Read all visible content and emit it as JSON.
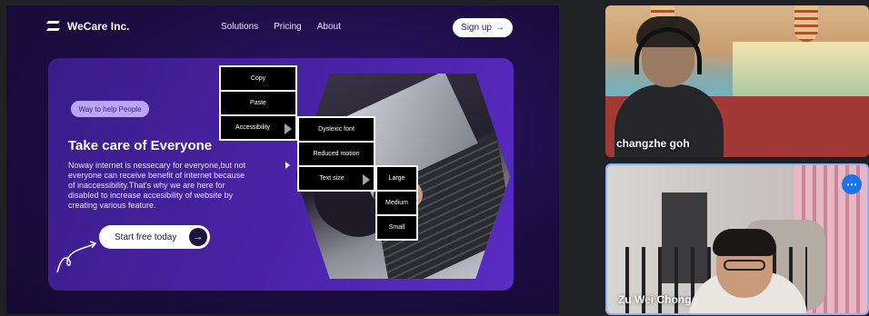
{
  "website": {
    "brand": "WeCare Inc.",
    "nav": [
      "Solutions",
      "Pricing",
      "About"
    ],
    "signup_label": "Sign up",
    "signup_arrow": "→",
    "badge": "Way to help People",
    "title": "Take care of Everyone",
    "description": "Noway internet is nessecary for everyone,but not everyone can receive benefit of internet because of inaccessibility.That's why we are here for disabled to increase accesibility of website by creating various feature.",
    "cta_label": "Start free today",
    "cta_arrow": "→"
  },
  "context_menu": {
    "main": [
      "Copy",
      "Paste",
      "Accessibility"
    ],
    "accessibility": [
      "Dyslexic font",
      "Reduced motion",
      "Text size"
    ],
    "text_size": [
      "Large",
      "Medium",
      "Small"
    ]
  },
  "participants": [
    {
      "name": "changzhe goh"
    },
    {
      "name": "Zu Wei Chong"
    }
  ],
  "more_options_icon": "⋯",
  "colors": {
    "accent": "#5a2cc4",
    "speaker_border": "#8ab4f8",
    "more_button": "#1a73e8"
  }
}
